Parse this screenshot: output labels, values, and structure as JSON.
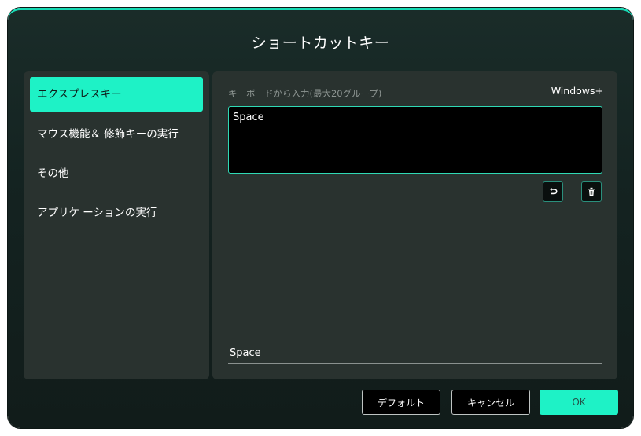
{
  "dialog": {
    "title": "ショートカットキー"
  },
  "sidebar": {
    "items": [
      {
        "label": "エクスプレスキー"
      },
      {
        "label": "マウス機能＆ 修飾キーの実行"
      },
      {
        "label": "その他"
      },
      {
        "label": "アプリケ ーションの実行"
      }
    ],
    "selected_index": 0
  },
  "main": {
    "input_label": "キーボードから入力(最大20グループ)",
    "modifier_label": "Windows+",
    "key_input_value": "Space",
    "undo_icon": "undo-icon",
    "delete_icon": "trash-icon",
    "result_value": "Space"
  },
  "footer": {
    "default_label": "デフォルト",
    "cancel_label": "キャンセル",
    "ok_label": "OK"
  },
  "colors": {
    "accent": "#1ef2c6",
    "panel": "#29322f",
    "background": "#142321"
  }
}
